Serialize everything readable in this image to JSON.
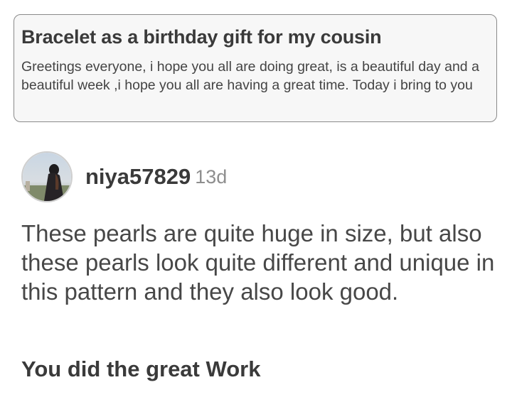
{
  "post": {
    "title": "Bracelet as a birthday gift for my cousin",
    "excerpt": "Greetings everyone, i hope you all are doing great, is a beautiful day and a beautiful week ,i hope you all are having a great time. Today i bring to you"
  },
  "comment": {
    "username": "niya57829",
    "timestamp": "13d",
    "body": "These pearls are quite huge in size, but also these pearls look quite different and unique in this pattern and they also look good.",
    "heading": "You did the great Work"
  },
  "colors": {
    "card_border": "#8a8a8a",
    "card_background": "#f7f7f7",
    "text": "#3a3a3a",
    "muted": "#8e8e8e"
  },
  "icons": {
    "avatar": "user-avatar-photo"
  }
}
